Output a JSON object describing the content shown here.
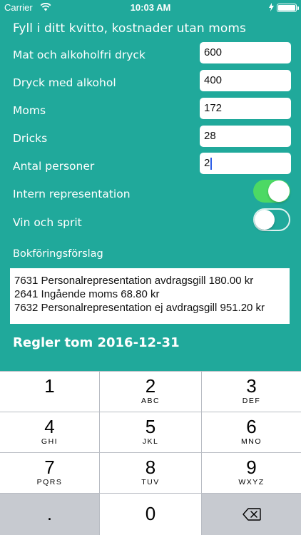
{
  "status": {
    "carrier": "Carrier",
    "time": "10:03 AM",
    "battery_level": 1.0
  },
  "form": {
    "heading": "Fyll i ditt kvitto, kostnader utan moms",
    "rows": [
      {
        "label": "Mat och alkoholfri dryck",
        "value": "600"
      },
      {
        "label": "Dryck med alkohol",
        "value": "400"
      },
      {
        "label": "Moms",
        "value": "172"
      },
      {
        "label": "Dricks",
        "value": "28"
      },
      {
        "label": "Antal personer",
        "value": "2"
      }
    ],
    "toggles": [
      {
        "label": "Intern representation",
        "on": true
      },
      {
        "label": "Vin och sprit",
        "on": false
      }
    ]
  },
  "booking": {
    "label": "Bokföringsförslag",
    "lines": [
      "7631 Personalrepresentation avdragsgill 180.00 kr",
      "2641 Ingående moms 68.80 kr",
      "7632 Personalrepresentation ej avdragsgill 951.20 kr"
    ]
  },
  "rules_text": "Regler tom 2016-12-31",
  "keyboard": {
    "keys": [
      {
        "digit": "1",
        "letters": ""
      },
      {
        "digit": "2",
        "letters": "ABC"
      },
      {
        "digit": "3",
        "letters": "DEF"
      },
      {
        "digit": "4",
        "letters": "GHI"
      },
      {
        "digit": "5",
        "letters": "JKL"
      },
      {
        "digit": "6",
        "letters": "MNO"
      },
      {
        "digit": "7",
        "letters": "PQRS"
      },
      {
        "digit": "8",
        "letters": "TUV"
      },
      {
        "digit": "9",
        "letters": "WXYZ"
      }
    ],
    "decimal": ".",
    "zero": "0",
    "delete_icon": "backspace-icon"
  },
  "colors": {
    "background": "#20A99B",
    "toggle_on": "#4CD964",
    "caret": "#2B5CE6"
  }
}
